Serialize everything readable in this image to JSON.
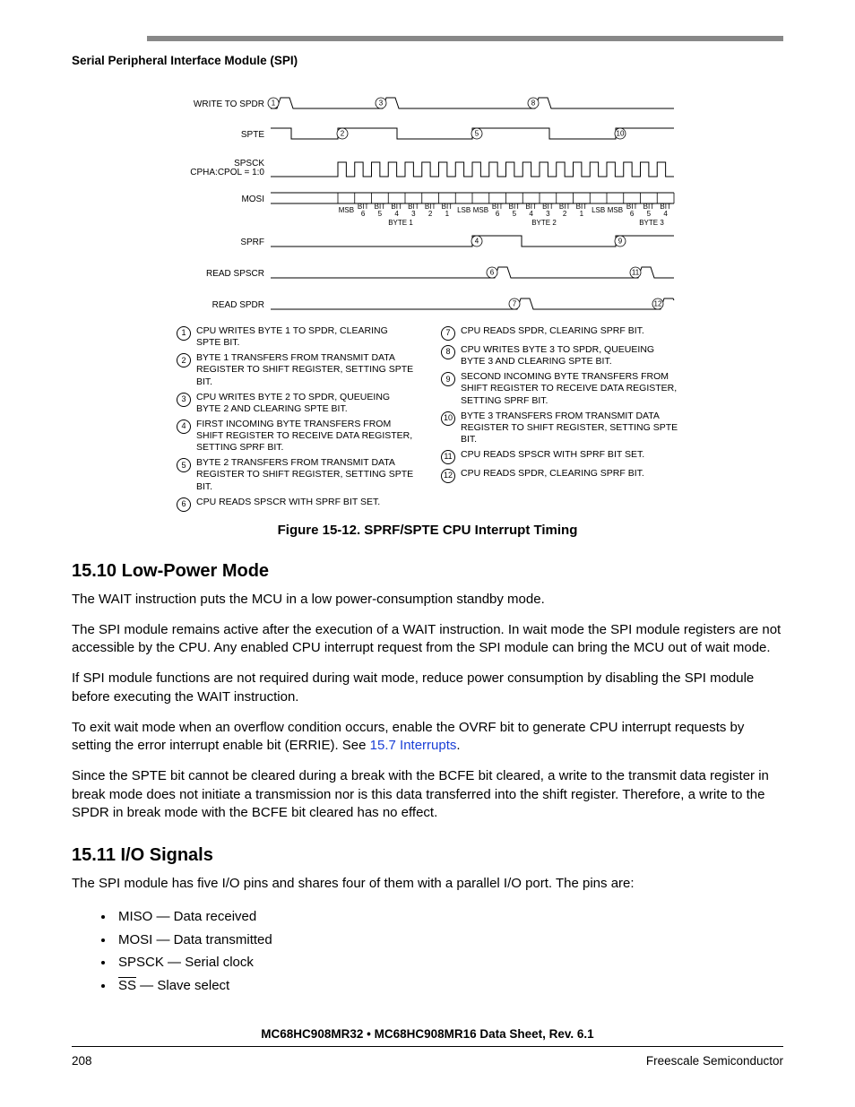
{
  "header": "Serial Peripheral Interface Module (SPI)",
  "timing": {
    "labels": {
      "write_spdr": "WRITE TO SPDR",
      "spte": "SPTE",
      "spsck1": "SPSCK",
      "spsck2": "CPHA:CPOL = 1:0",
      "mosi": "MOSI",
      "sprf": "SPRF",
      "read_spscr": "READ SPSCR",
      "read_spdr": "READ SPDR",
      "byte1": "BYTE 1",
      "byte2": "BYTE 2",
      "byte3": "BYTE 3"
    },
    "bits": [
      "MSB",
      "BIT 6",
      "BIT 5",
      "BIT 4",
      "BIT 3",
      "BIT 2",
      "BIT 1",
      "LSB"
    ],
    "byte3bits": [
      "MSB",
      "BIT 6",
      "BIT 5",
      "BIT 4"
    ],
    "markers": [
      "1",
      "2",
      "3",
      "4",
      "5",
      "6",
      "7",
      "8",
      "9",
      "10",
      "11",
      "12"
    ]
  },
  "legend_left": [
    {
      "n": "1",
      "t": "CPU WRITES BYTE 1 TO SPDR, CLEARING SPTE BIT."
    },
    {
      "n": "2",
      "t": "BYTE 1 TRANSFERS FROM TRANSMIT DATA REGISTER TO SHIFT REGISTER, SETTING SPTE BIT."
    },
    {
      "n": "3",
      "t": "CPU WRITES BYTE 2 TO SPDR, QUEUEING BYTE 2 AND CLEARING SPTE BIT."
    },
    {
      "n": "4",
      "t": "FIRST INCOMING BYTE TRANSFERS FROM SHIFT REGISTER TO RECEIVE DATA REGISTER, SETTING SPRF BIT."
    },
    {
      "n": "5",
      "t": "BYTE 2 TRANSFERS FROM TRANSMIT DATA REGISTER TO SHIFT REGISTER, SETTING SPTE BIT."
    },
    {
      "n": "6",
      "t": "CPU READS SPSCR WITH SPRF BIT SET."
    }
  ],
  "legend_right": [
    {
      "n": "7",
      "t": "CPU READS SPDR, CLEARING SPRF BIT."
    },
    {
      "n": "8",
      "t": "CPU WRITES BYTE 3 TO SPDR, QUEUEING BYTE 3 AND CLEARING SPTE BIT."
    },
    {
      "n": "9",
      "t": "SECOND INCOMING BYTE TRANSFERS FROM SHIFT REGISTER TO RECEIVE DATA REGISTER, SETTING SPRF BIT."
    },
    {
      "n": "10",
      "t": "BYTE 3 TRANSFERS FROM TRANSMIT DATA REGISTER TO SHIFT REGISTER, SETTING SPTE BIT."
    },
    {
      "n": "11",
      "t": "CPU READS SPSCR WITH SPRF BIT SET."
    },
    {
      "n": "12",
      "t": "CPU READS SPDR, CLEARING SPRF BIT."
    }
  ],
  "figure_caption": "Figure 15-12. SPRF/SPTE CPU Interrupt Timing",
  "sec1": {
    "title": "15.10  Low-Power Mode",
    "p1": "The WAIT instruction puts the MCU in a low power-consumption standby mode.",
    "p2": "The SPI module remains active after the execution of a WAIT instruction. In wait mode the SPI module registers are not accessible by the CPU. Any enabled CPU interrupt request from the SPI module can bring the MCU out of wait mode.",
    "p3": "If SPI module functions are not required during wait mode, reduce power consumption by disabling the SPI module before executing the WAIT instruction.",
    "p4a": "To exit wait mode when an overflow condition occurs, enable the OVRF bit to generate CPU interrupt requests by setting the error interrupt enable bit (ERRIE). See ",
    "p4link": "15.7 Interrupts",
    "p4b": ".",
    "p5": "Since the SPTE bit cannot be cleared during a break with the BCFE bit cleared, a write to the transmit data register in break mode does not initiate a transmission nor is this data transferred into the shift register. Therefore, a write to the SPDR in break mode with the BCFE bit cleared has no effect."
  },
  "sec2": {
    "title": "15.11  I/O Signals",
    "intro": "The SPI module has five I/O pins and shares four of them with a parallel I/O port. The pins are:",
    "pins": [
      {
        "name": "MISO",
        "desc": "Data received"
      },
      {
        "name": "MOSI",
        "desc": "Data transmitted"
      },
      {
        "name": "SPSCK",
        "desc": "Serial clock"
      },
      {
        "name": "SS",
        "desc": "Slave select",
        "overline": true
      }
    ]
  },
  "footer": {
    "doc": "MC68HC908MR32 • MC68HC908MR16 Data Sheet, Rev. 6.1",
    "page": "208",
    "company": "Freescale Semiconductor"
  }
}
